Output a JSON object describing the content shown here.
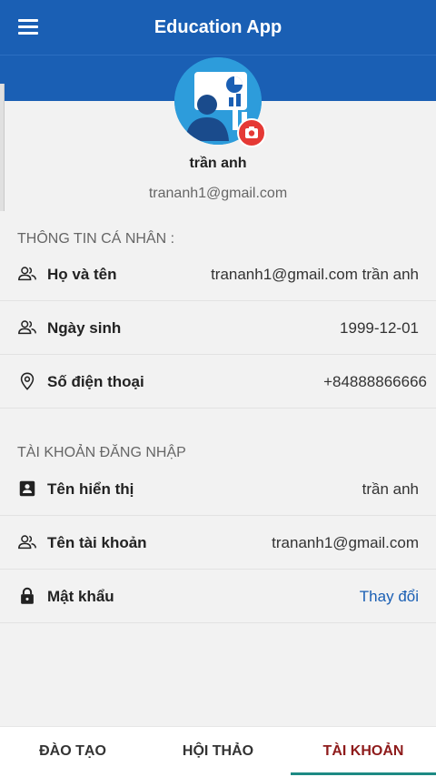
{
  "app": {
    "title": "Education App"
  },
  "profile": {
    "name": "trần anh",
    "email": "trananh1@gmail.com"
  },
  "personal_section": {
    "title": "THÔNG TIN CÁ NHÂN :",
    "rows": [
      {
        "label": "Họ và tên",
        "value": "trananh1@gmail.com trần anh",
        "icon": "people-icon"
      },
      {
        "label": "Ngày sinh",
        "value": "1999-12-01",
        "icon": "people-icon"
      },
      {
        "label": "Số điện thoại",
        "value": "+84888866666",
        "icon": "location-pin-icon"
      }
    ]
  },
  "account_section": {
    "title": "TÀI KHOẢN ĐĂNG NHẬP",
    "rows": [
      {
        "label": "Tên hiển thị",
        "value": "trần anh",
        "icon": "id-card-icon"
      },
      {
        "label": "Tên tài khoản",
        "value": "trananh1@gmail.com",
        "icon": "people-icon"
      },
      {
        "label": "Mật khẩu",
        "value": "Thay đổi",
        "icon": "lock-icon"
      }
    ]
  },
  "bottom_nav": {
    "tabs": [
      {
        "label": "ĐÀO TẠO"
      },
      {
        "label": "HỘI THẢO"
      },
      {
        "label": "TÀI KHOẢN"
      }
    ],
    "active_index": 2
  },
  "colors": {
    "primary": "#1a5fb4",
    "active_tab": "#8e1b1b",
    "indicator": "#1d8a84",
    "camera_badge": "#e53935"
  }
}
